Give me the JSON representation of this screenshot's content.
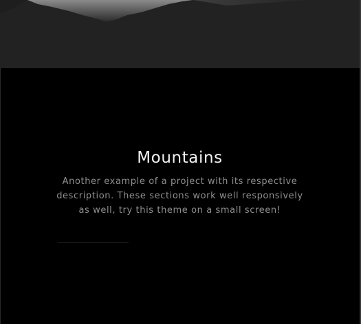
{
  "project": {
    "title": "Mountains",
    "description": "Another example of a project with its respective description. These sections work well responsively as well, try this theme on a small screen!"
  },
  "colors": {
    "background": "#000000",
    "title": "#f2f2f2",
    "description": "#8f8f8f"
  }
}
